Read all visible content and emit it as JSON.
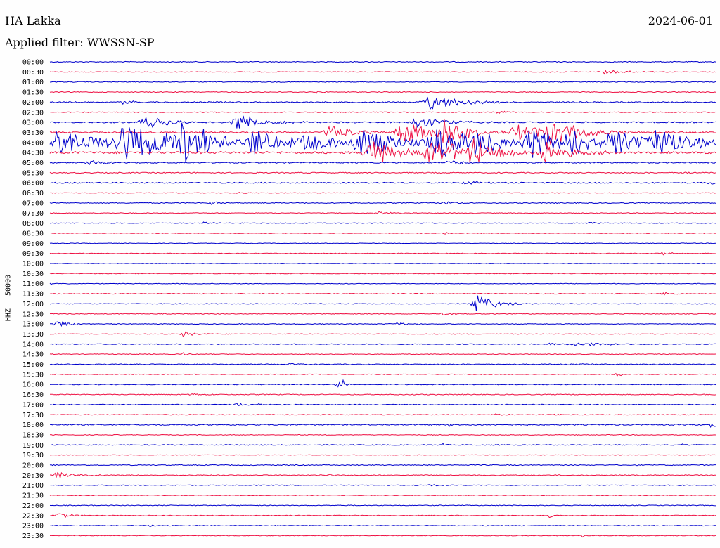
{
  "header": {
    "station": "HA Lakka",
    "date": "2024-06-01",
    "filter": "Applied filter: WWSSN-SP"
  },
  "chart_data": {
    "type": "line",
    "subtype": "helicorder",
    "ylabel": "HHZ - 50000",
    "row_labels": [
      "00:00",
      "00:30",
      "01:00",
      "01:30",
      "02:00",
      "02:30",
      "03:00",
      "03:30",
      "04:00",
      "04:30",
      "05:00",
      "05:30",
      "06:00",
      "06:30",
      "07:00",
      "07:30",
      "08:00",
      "08:30",
      "09:00",
      "09:30",
      "10:00",
      "10:30",
      "11:00",
      "11:30",
      "12:00",
      "12:30",
      "13:00",
      "13:30",
      "14:00",
      "14:30",
      "15:00",
      "15:30",
      "16:00",
      "16:30",
      "17:00",
      "17:30",
      "18:00",
      "18:30",
      "19:00",
      "19:30",
      "20:00",
      "20:30",
      "21:00",
      "21:30",
      "22:00",
      "22:30",
      "23:00",
      "23:30"
    ],
    "series_colors": [
      "#0000cc",
      "#ee1144"
    ],
    "color_pattern": "alternating by row",
    "noise_level": [
      1.2,
      1.0,
      1.0,
      1.2,
      1.6,
      1.2,
      1.8,
      2.0,
      3.0,
      3.0,
      1.6,
      1.4,
      1.6,
      1.0,
      1.2,
      1.0,
      1.0,
      1.0,
      0.8,
      1.0,
      0.8,
      1.0,
      0.8,
      1.2,
      1.0,
      1.0,
      1.0,
      1.0,
      1.2,
      1.0,
      1.2,
      1.0,
      1.2,
      1.2,
      1.2,
      1.0,
      1.6,
      1.0,
      1.2,
      0.8,
      1.2,
      1.2,
      1.0,
      1.0,
      1.0,
      1.0,
      1.0,
      1.0
    ],
    "events": [
      {
        "row": 1,
        "x": 0.83,
        "amp": 4,
        "dur": 0.04
      },
      {
        "row": 1,
        "x": 0.74,
        "amp": 2,
        "dur": 0.01
      },
      {
        "row": 3,
        "x": 0.4,
        "amp": 2,
        "dur": 0.01
      },
      {
        "row": 4,
        "x": 0.11,
        "amp": 6,
        "dur": 0.01
      },
      {
        "row": 4,
        "x": 0.57,
        "amp": 12,
        "dur": 0.05
      },
      {
        "row": 5,
        "x": 0.67,
        "amp": 3,
        "dur": 0.02
      },
      {
        "row": 6,
        "x": 0.14,
        "amp": 10,
        "dur": 0.04
      },
      {
        "row": 6,
        "x": 0.28,
        "amp": 14,
        "dur": 0.04
      },
      {
        "row": 6,
        "x": 0.55,
        "amp": 12,
        "dur": 0.04
      },
      {
        "row": 7,
        "x": 0.42,
        "amp": 12,
        "dur": 0.04
      },
      {
        "row": 7,
        "x": 0.53,
        "amp": 18,
        "dur": 0.06
      },
      {
        "row": 7,
        "x": 0.59,
        "amp": 20,
        "dur": 0.04
      },
      {
        "row": 7,
        "x": 0.7,
        "amp": 14,
        "dur": 0.06
      },
      {
        "row": 7,
        "x": 0.75,
        "amp": 18,
        "dur": 0.06
      },
      {
        "row": 8,
        "x": 0.01,
        "amp": 18,
        "dur": 0.07
      },
      {
        "row": 8,
        "x": 0.11,
        "amp": 30,
        "dur": 0.09
      },
      {
        "row": 8,
        "x": 0.2,
        "amp": 26,
        "dur": 0.06
      },
      {
        "row": 8,
        "x": 0.3,
        "amp": 20,
        "dur": 0.06
      },
      {
        "row": 8,
        "x": 0.38,
        "amp": 14,
        "dur": 0.05
      },
      {
        "row": 8,
        "x": 0.46,
        "amp": 26,
        "dur": 0.06
      },
      {
        "row": 8,
        "x": 0.58,
        "amp": 28,
        "dur": 0.06
      },
      {
        "row": 8,
        "x": 0.64,
        "amp": 18,
        "dur": 0.05
      },
      {
        "row": 8,
        "x": 0.72,
        "amp": 24,
        "dur": 0.05
      },
      {
        "row": 8,
        "x": 0.78,
        "amp": 20,
        "dur": 0.04
      },
      {
        "row": 8,
        "x": 0.84,
        "amp": 22,
        "dur": 0.05
      },
      {
        "row": 8,
        "x": 0.91,
        "amp": 24,
        "dur": 0.06
      },
      {
        "row": 9,
        "x": 0.48,
        "amp": 20,
        "dur": 0.05
      },
      {
        "row": 9,
        "x": 0.57,
        "amp": 22,
        "dur": 0.06
      },
      {
        "row": 9,
        "x": 0.63,
        "amp": 20,
        "dur": 0.05
      },
      {
        "row": 9,
        "x": 0.74,
        "amp": 18,
        "dur": 0.04
      },
      {
        "row": 10,
        "x": 0.06,
        "amp": 4,
        "dur": 0.03
      },
      {
        "row": 10,
        "x": 0.6,
        "amp": 4,
        "dur": 0.03
      },
      {
        "row": 11,
        "x": 0.95,
        "amp": 3,
        "dur": 0.01
      },
      {
        "row": 12,
        "x": 0.62,
        "amp": 2,
        "dur": 0.04
      },
      {
        "row": 12,
        "x": 0.99,
        "amp": 3,
        "dur": 0.03
      },
      {
        "row": 13,
        "x": 0.28,
        "amp": 2,
        "dur": 0.01
      },
      {
        "row": 14,
        "x": 0.24,
        "amp": 4,
        "dur": 0.01
      },
      {
        "row": 14,
        "x": 0.59,
        "amp": 3,
        "dur": 0.02
      },
      {
        "row": 15,
        "x": 0.49,
        "amp": 2,
        "dur": 0.03
      },
      {
        "row": 16,
        "x": 0.23,
        "amp": 2,
        "dur": 0.02
      },
      {
        "row": 16,
        "x": 0.81,
        "amp": 4,
        "dur": 0.01
      },
      {
        "row": 17,
        "x": 0.59,
        "amp": 3,
        "dur": 0.01
      },
      {
        "row": 19,
        "x": 0.92,
        "amp": 4,
        "dur": 0.01
      },
      {
        "row": 22,
        "x": 0.0,
        "amp": 1,
        "dur": 0.01
      },
      {
        "row": 23,
        "x": 0.92,
        "amp": 3,
        "dur": 0.01
      },
      {
        "row": 24,
        "x": 0.64,
        "amp": 14,
        "dur": 0.03
      },
      {
        "row": 25,
        "x": 0.59,
        "amp": 3,
        "dur": 0.02
      },
      {
        "row": 26,
        "x": 0.01,
        "amp": 7,
        "dur": 0.02
      },
      {
        "row": 26,
        "x": 0.52,
        "amp": 2,
        "dur": 0.04
      },
      {
        "row": 27,
        "x": 0.2,
        "amp": 4,
        "dur": 0.02
      },
      {
        "row": 28,
        "x": 0.79,
        "amp": 3,
        "dur": 0.06
      },
      {
        "row": 28,
        "x": 0.75,
        "amp": 2,
        "dur": 0.01
      },
      {
        "row": 29,
        "x": 0.2,
        "amp": 3,
        "dur": 0.01
      },
      {
        "row": 30,
        "x": 0.36,
        "amp": 2,
        "dur": 0.01
      },
      {
        "row": 30,
        "x": 0.8,
        "amp": 2,
        "dur": 0.01
      },
      {
        "row": 31,
        "x": 0.85,
        "amp": 4,
        "dur": 0.01
      },
      {
        "row": 32,
        "x": 0.43,
        "amp": 7,
        "dur": 0.01
      },
      {
        "row": 32,
        "x": 0.44,
        "amp": 10,
        "dur": 0.005
      },
      {
        "row": 33,
        "x": 0.21,
        "amp": 2,
        "dur": 0.02
      },
      {
        "row": 34,
        "x": 0.28,
        "amp": 4,
        "dur": 0.01
      },
      {
        "row": 34,
        "x": 0.3,
        "amp": 2,
        "dur": 0.02
      },
      {
        "row": 35,
        "x": 0.67,
        "amp": 2,
        "dur": 0.01
      },
      {
        "row": 35,
        "x": 0.76,
        "amp": 2,
        "dur": 0.01
      },
      {
        "row": 36,
        "x": 0.6,
        "amp": 4,
        "dur": 0.005
      },
      {
        "row": 36,
        "x": 0.99,
        "amp": 5,
        "dur": 0.02
      },
      {
        "row": 38,
        "x": 0.59,
        "amp": 4,
        "dur": 0.005
      },
      {
        "row": 38,
        "x": 0.95,
        "amp": 3,
        "dur": 0.01
      },
      {
        "row": 41,
        "x": 0.01,
        "amp": 5,
        "dur": 0.03
      },
      {
        "row": 41,
        "x": 0.42,
        "amp": 4,
        "dur": 0.005
      },
      {
        "row": 42,
        "x": 0.57,
        "amp": 2,
        "dur": 0.02
      },
      {
        "row": 45,
        "x": 0.01,
        "amp": 6,
        "dur": 0.02
      },
      {
        "row": 45,
        "x": 0.75,
        "amp": 4,
        "dur": 0.005
      },
      {
        "row": 46,
        "x": 0.15,
        "amp": 2,
        "dur": 0.01
      },
      {
        "row": 47,
        "x": 0.8,
        "amp": 3,
        "dur": 0.005
      }
    ]
  }
}
